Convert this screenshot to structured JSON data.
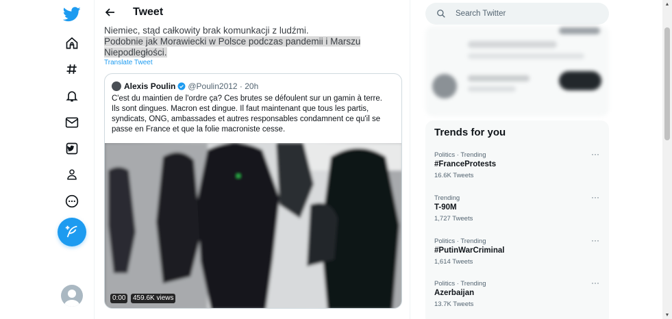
{
  "nav": {
    "items": [
      {
        "name": "twitter-logo-icon"
      },
      {
        "name": "home-icon"
      },
      {
        "name": "explore-hashtag-icon"
      },
      {
        "name": "notifications-bell-icon"
      },
      {
        "name": "messages-envelope-icon"
      },
      {
        "name": "bookmarks-icon"
      },
      {
        "name": "profile-person-icon"
      },
      {
        "name": "more-circle-icon"
      }
    ],
    "compose_icon": "feather-plus-icon",
    "accent": "#1d9bf0"
  },
  "header": {
    "title": "Tweet"
  },
  "tweet": {
    "line1": "Niemiec, stąd całkowity brak komunkacji z ludźmi.",
    "line2": "Podobnie jak Morawiecki w Polsce podczas pandemii i Marszu",
    "line3": "Niepodległości.",
    "translate": "Translate Tweet"
  },
  "quote": {
    "name": "Alexis Poulin",
    "handle_time": "@Poulin2012 · 20h",
    "lines": [
      "C'est du maintien de l'ordre ça? Ces brutes se défoulent sur un gamin à terre.",
      "Ils sont dingues. Macron est dingue. Il faut  maintenant que tous les partis,",
      "syndicats, ONG, ambassades et autres responsables condamnent ce qu'il se",
      "passe en France et que la folie macroniste cesse."
    ],
    "video_time": "0:00",
    "video_views": "459.6K views"
  },
  "search": {
    "placeholder": "Search Twitter"
  },
  "trends": {
    "title": "Trends for you",
    "items": [
      {
        "meta": "Politics · Trending",
        "name": "#FranceProtests",
        "count": "16.6K Tweets"
      },
      {
        "meta": "Trending",
        "name": "T-90M",
        "count": "1,727 Tweets"
      },
      {
        "meta": "Politics · Trending",
        "name": "#PutinWarCriminal",
        "count": "1,614 Tweets"
      },
      {
        "meta": "Politics · Trending",
        "name": "Azerbaijan",
        "count": "13.7K Tweets"
      }
    ],
    "more_glyph": "···"
  }
}
